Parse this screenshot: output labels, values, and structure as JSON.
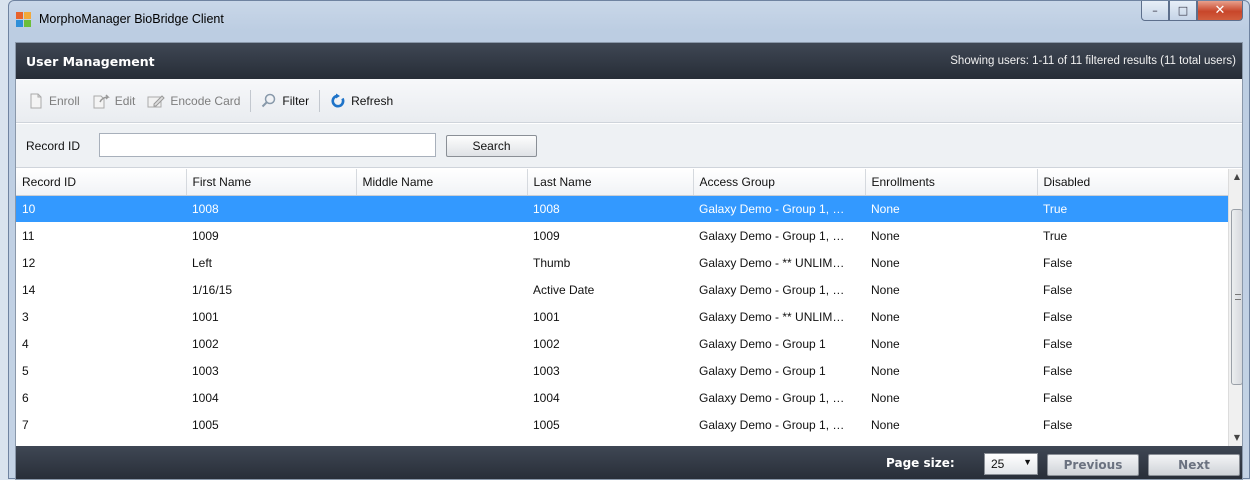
{
  "window": {
    "title": "MorphoManager BioBridge Client",
    "controls": {
      "minimize": "–",
      "maximize": "□",
      "close": "✕"
    }
  },
  "header": {
    "title": "User Management",
    "status": "Showing users: 1-11 of 11 filtered results (11 total users)"
  },
  "toolbar": {
    "enroll": "Enroll",
    "edit": "Edit",
    "encode_card": "Encode Card",
    "filter": "Filter",
    "refresh": "Refresh"
  },
  "search": {
    "label": "Record ID",
    "value": "",
    "button": "Search"
  },
  "table": {
    "columns": [
      "Record ID",
      "First Name",
      "Middle Name",
      "Last Name",
      "Access Group",
      "Enrollments",
      "Disabled"
    ],
    "rows": [
      [
        "10",
        "1008",
        "",
        "1008",
        "Galaxy Demo - Group 1, …",
        "None",
        "True"
      ],
      [
        "11",
        "1009",
        "",
        "1009",
        "Galaxy Demo - Group 1, …",
        "None",
        "True"
      ],
      [
        "12",
        "Left",
        "",
        "Thumb",
        "Galaxy Demo - ** UNLIM…",
        "None",
        "False"
      ],
      [
        "14",
        "1/16/15",
        "",
        "Active Date",
        "Galaxy Demo - Group 1, …",
        "None",
        "False"
      ],
      [
        "3",
        "1001",
        "",
        "1001",
        "Galaxy Demo - ** UNLIM…",
        "None",
        "False"
      ],
      [
        "4",
        "1002",
        "",
        "1002",
        "Galaxy Demo - Group 1",
        "None",
        "False"
      ],
      [
        "5",
        "1003",
        "",
        "1003",
        "Galaxy Demo - Group 1",
        "None",
        "False"
      ],
      [
        "6",
        "1004",
        "",
        "1004",
        "Galaxy Demo - Group 1, …",
        "None",
        "False"
      ],
      [
        "7",
        "1005",
        "",
        "1005",
        "Galaxy Demo - Group 1, …",
        "None",
        "False"
      ]
    ],
    "selected_row": 0
  },
  "scrollbar": {
    "up": "▲",
    "down": "▼",
    "menu": "≡"
  },
  "footer": {
    "page_size_label": "Page size:",
    "page_size_value": "25",
    "page_size_caret": "▼",
    "previous": "Previous",
    "next": "Next"
  },
  "colors": {
    "selection": "#3399ff",
    "header_bg": "#2e3440",
    "refresh_icon": "#1e73c8",
    "title_bg": "#c9d7e8"
  }
}
